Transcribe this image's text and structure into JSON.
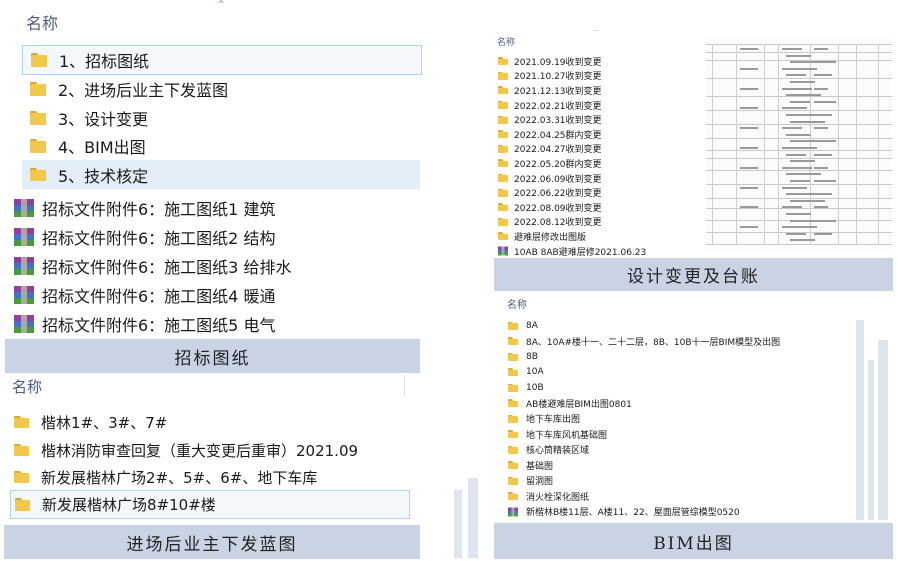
{
  "panel_tender": {
    "header": "名称",
    "folders": [
      "1、招标图纸",
      "2、进场后业主下发蓝图",
      "3、设计变更",
      "4、BIM出图",
      "5、技术核定"
    ],
    "files": [
      "招标文件附件6：施工图纸1 建筑",
      "招标文件附件6：施工图纸2 结构",
      "招标文件附件6：施工图纸3 给排水",
      "招标文件附件6：施工图纸4 暖通",
      "招标文件附件6：施工图纸5 电气"
    ],
    "caption": "招标图纸",
    "icons": {
      "folder": "folder-icon",
      "archive": "rar-archive-icon",
      "sort": "sort-up-icon"
    }
  },
  "panel_blueprints": {
    "header": "名称",
    "folders": [
      "楷林1#、3#、7#",
      "楷林消防审查回复（重大变更后重审）2021.09",
      "新发展楷林广场2#、5#、6#、地下车库",
      "新发展楷林广场8#10#楼"
    ],
    "caption": "进场后业主下发蓝图"
  },
  "panel_changes": {
    "header": "名称",
    "folders": [
      "2021.09.19收到变更",
      "2021.10.27收到变更",
      "2021.12.13收到变更",
      "2022.02.21收到变更",
      "2022.03.31收到变更",
      "2022.04.25群内变更",
      "2022.04.27收到变更",
      "2022.05.20群内变更",
      "2022.06.09收到变更",
      "2022.06.22收到变更",
      "2022.08.09收到变更",
      "2022.08.12收到变更",
      "避难层修改出图版"
    ],
    "archive": "10AB 8AB避难层修2021.06.23",
    "caption": "设计变更及台账"
  },
  "panel_bim": {
    "header": "名称",
    "folders": [
      "8A",
      "8A、10A#楼十一、二十二层，8B、10B十一层BIM模型及出图",
      "8B",
      "10A",
      "10B",
      "AB楼避难层BIM出图0801",
      "地下车库出图",
      "地下车库风机基础图",
      "核心筒精装区域",
      "基础图",
      "留洞图",
      "消火栓深化图纸"
    ],
    "archive": "新楷林B楼11层、A楼11、22、屋面层管综模型0520",
    "caption": "BIM出图"
  },
  "colors": {
    "caption_bg": "#c9d3e3",
    "folder": "#f2c84b",
    "header_text": "#4d5e80",
    "selection": "#e2edf8"
  }
}
